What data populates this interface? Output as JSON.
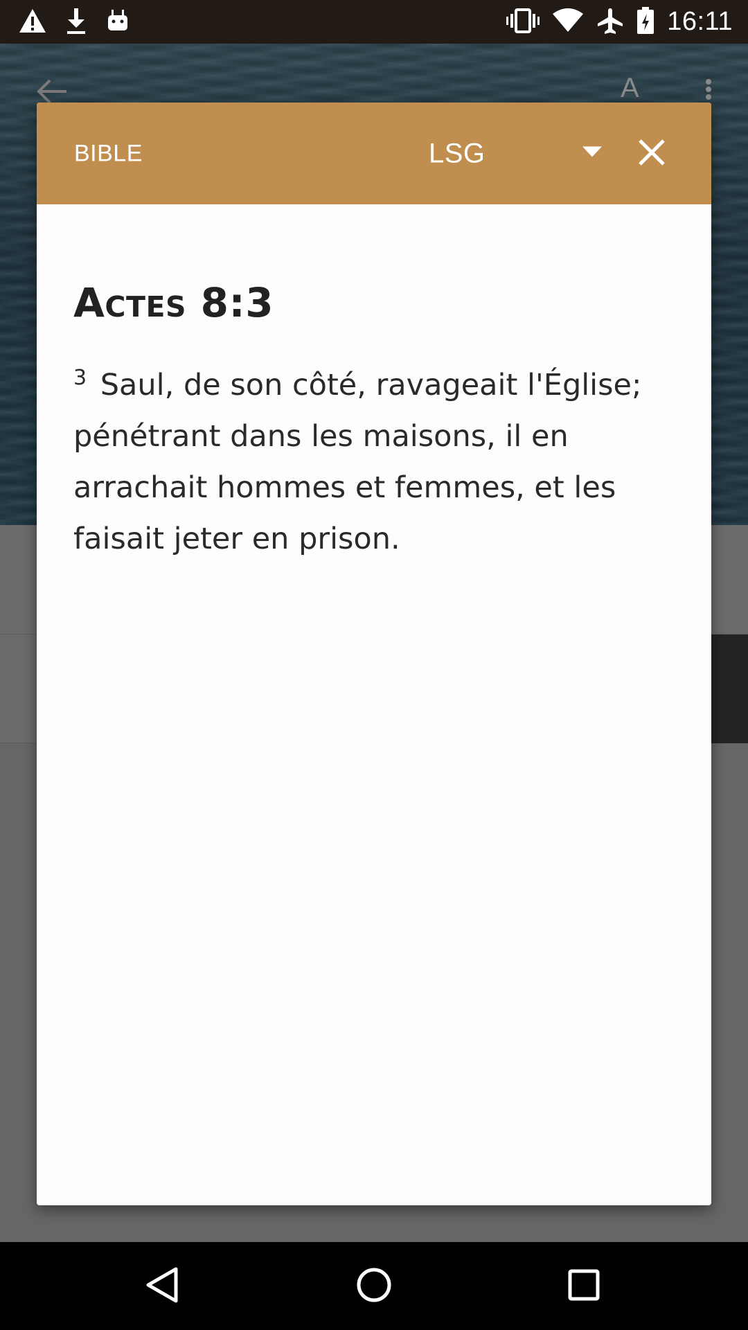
{
  "status_bar": {
    "time": "16:11",
    "left_icons": [
      "warning-icon",
      "download-icon",
      "android-icon"
    ],
    "right_icons": [
      "vibrate-icon",
      "wifi-icon",
      "airplane-icon",
      "battery-icon"
    ]
  },
  "background_app": {
    "font_button_label": "A"
  },
  "dialog": {
    "header": {
      "title": "BIBLE",
      "version": "LSG",
      "bg_color": "#c08f50"
    },
    "reference": "Actes 8:3",
    "verse": {
      "number": "3",
      "text": "Saul, de son côté, ravageait l'Église; pénétrant dans les maisons, il en arrachait hommes et femmes, et les faisait jeter en prison."
    }
  },
  "nav_bar": {
    "buttons": [
      "back-icon",
      "home-icon",
      "recents-icon"
    ]
  }
}
